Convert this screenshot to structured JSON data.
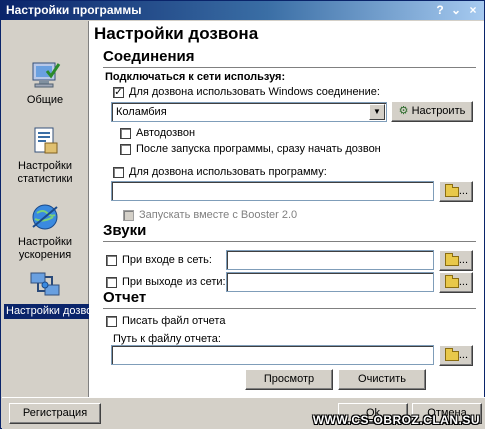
{
  "window": {
    "title": "Настройки программы",
    "help_glyph": "?",
    "pin_glyph": "⌄",
    "close_glyph": "×"
  },
  "sidebar": {
    "items": [
      {
        "label": "Общие",
        "icon": "monitor-check-icon"
      },
      {
        "label": "Настройки статистики",
        "icon": "statistics-sheet-icon"
      },
      {
        "label": "Настройки ускорения",
        "icon": "globe-speed-icon"
      },
      {
        "label": "Настройки дозвона",
        "icon": "network-computers-icon",
        "active": true
      }
    ]
  },
  "page": {
    "title": "Настройки дозвона",
    "connections": {
      "title": "Соединения",
      "connect_label": "Подключаться к сети используя:",
      "use_windows_label": "Для дозвона использовать Windows соединение:",
      "use_windows_checked": true,
      "connection_value": "Коламбия",
      "configure_button": "Настроить",
      "autodial_label": "Автодозвон",
      "autodial_checked": false,
      "dial_on_start_label": "После запуска программы, сразу начать дозвон",
      "dial_on_start_checked": false,
      "use_program_label": "Для дозвона использовать программу:",
      "use_program_checked": false,
      "program_path": "",
      "launch_with_booster_label": "Запускать вместе с Booster 2.0",
      "launch_with_booster_checked": false
    },
    "sounds": {
      "title": "Звуки",
      "on_connect_label": "При входе в сеть:",
      "on_connect_checked": false,
      "on_connect_value": "",
      "on_disconnect_label": "При выходе из сети:",
      "on_disconnect_checked": false,
      "on_disconnect_value": ""
    },
    "report": {
      "title": "Отчет",
      "write_report_label": "Писать файл отчета",
      "write_report_checked": false,
      "report_path_label": "Путь к файлу отчета:",
      "report_path_value": "",
      "view_button": "Просмотр",
      "clear_button": "Очистить"
    }
  },
  "footer": {
    "register_button": "Регистрация",
    "ok_button": "Ok",
    "cancel_button": "Отмена"
  },
  "watermark": "WWW.CS-OBROZ.CLAN.SU",
  "colors": {
    "titlebar_start": "#0a246a",
    "active_item": "#0a246a",
    "window_bg": "#d4d0c8"
  }
}
